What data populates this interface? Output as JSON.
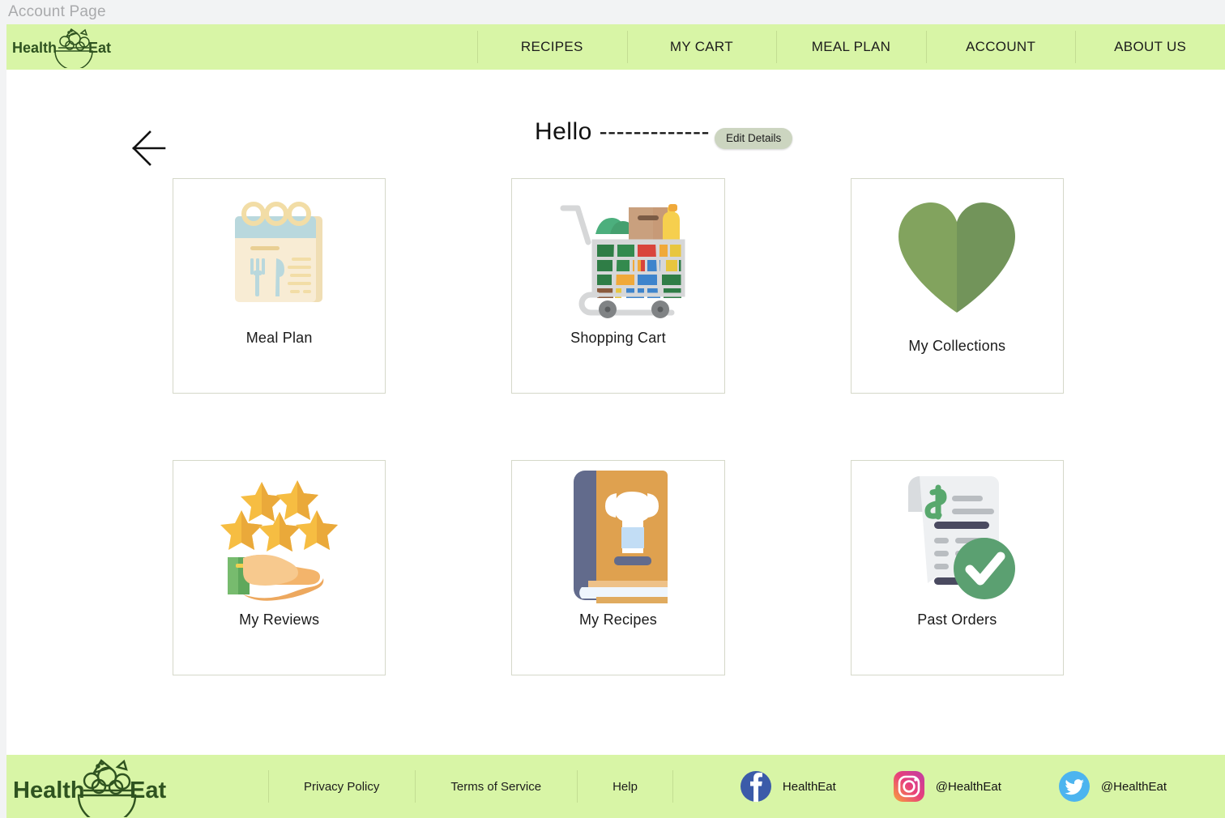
{
  "window": {
    "title": "Account Page"
  },
  "brand": {
    "name_left": "Health",
    "name_right": "Eat",
    "logo_icon": "salad-bowl-icon"
  },
  "nav": {
    "items": [
      {
        "label": "RECIPES"
      },
      {
        "label": "MY CART"
      },
      {
        "label": "MEAL PLAN"
      },
      {
        "label": "ACCOUNT"
      },
      {
        "label": "ABOUT US"
      }
    ]
  },
  "header": {
    "back_icon": "left-arrow-icon",
    "greeting": "Hello -------------",
    "edit_button": "Edit Details"
  },
  "cards": [
    {
      "label": "Meal Plan",
      "icon": "calendar-meal-plan-icon"
    },
    {
      "label": "Shopping Cart",
      "icon": "shopping-cart-icon"
    },
    {
      "label": "My Collections",
      "icon": "heart-icon"
    },
    {
      "label": "My Reviews",
      "icon": "stars-hand-icon"
    },
    {
      "label": "My Recipes",
      "icon": "recipe-book-icon"
    },
    {
      "label": "Past Orders",
      "icon": "receipt-check-icon"
    }
  ],
  "footer": {
    "links": [
      {
        "label": "Privacy Policy"
      },
      {
        "label": "Terms of Service"
      },
      {
        "label": "Help"
      }
    ],
    "socials": [
      {
        "platform": "facebook",
        "handle": "HealthEat"
      },
      {
        "platform": "instagram",
        "handle": "@HealthEat"
      },
      {
        "platform": "twitter",
        "handle": "@HealthEat"
      }
    ]
  },
  "colors": {
    "brand_green": "#d8f5a6",
    "logo_dark_green": "#2f5320",
    "card_border": "#d5d8c9",
    "button_sage": "#ccd5c0",
    "heart_green": "#7d9e5c",
    "page_background": "#ffffff",
    "chrome_gray": "#f2f3f4"
  }
}
